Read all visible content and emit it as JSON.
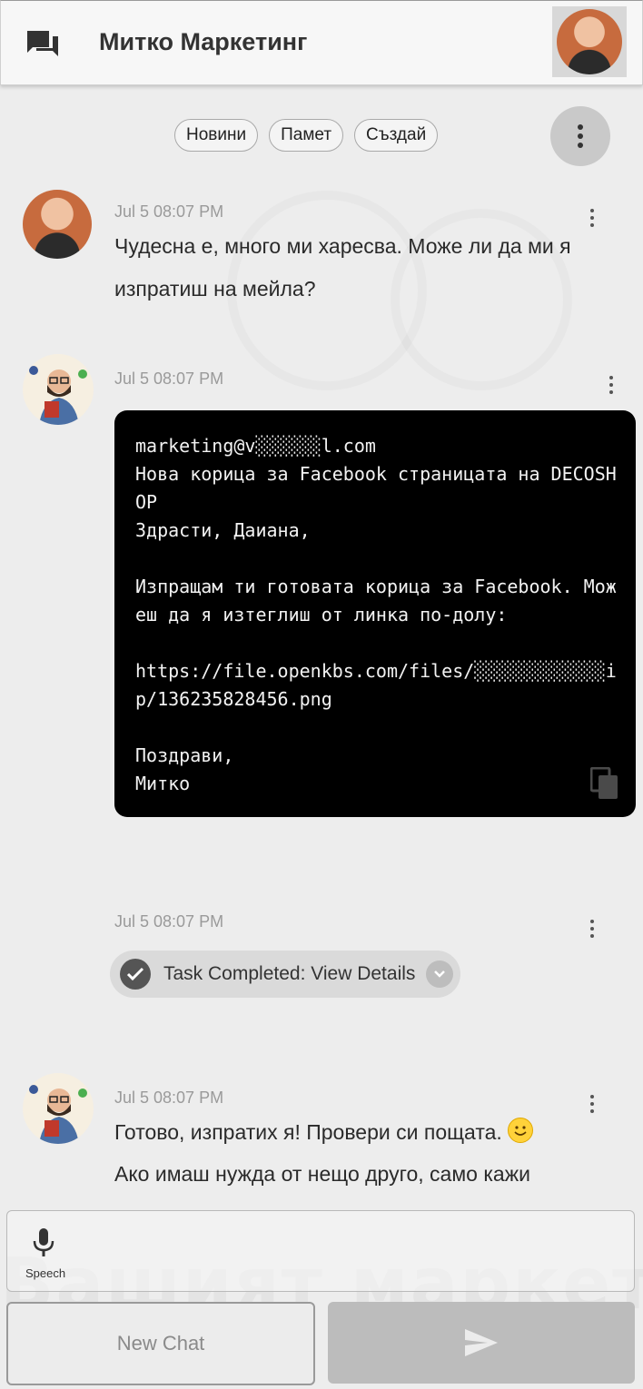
{
  "header": {
    "title": "Митко Маркетинг",
    "chat_icon": "forum-icon",
    "user_avatar": "user-avatar"
  },
  "chips": [
    "Новини",
    "Памет",
    "Създай"
  ],
  "messages": [
    {
      "sender": "user",
      "timestamp": "Jul 5 08:07 PM",
      "text_line1": "Чудесна е, много ми харесва. Може ли да ми я",
      "text_line2": "изпратиш на мейла?"
    },
    {
      "sender": "assistant",
      "timestamp": "Jul 5 08:07 PM",
      "code": "marketing@v░░░░░░l.com\nНова корица за Facebook страницата на DECOSHOP\nЗдрасти, Даиана,\n\nИзпращам ти готовата корица за Facebook. Можеш да я изтеглиш от линка по-долу:\n\nhttps://file.openkbs.com/files/░░░░░░░░░░░░ip/136235828456.png\n\nПоздрави,\nМитко"
    },
    {
      "sender": "assistant",
      "timestamp": "Jul 5 08:07 PM",
      "task_label": "Task Completed: View Details"
    },
    {
      "sender": "assistant",
      "timestamp": "Jul 5 08:07 PM",
      "text_line1": "Готово, изпратих я! Провери си пощата.",
      "text_line2": "Ако имаш нужда от нещо друго, само кажи"
    }
  ],
  "input": {
    "speech_label": "Speech"
  },
  "buttons": {
    "new_chat": "New Chat",
    "send_icon": "send-icon"
  },
  "watermark": "Вашият маркетинг"
}
